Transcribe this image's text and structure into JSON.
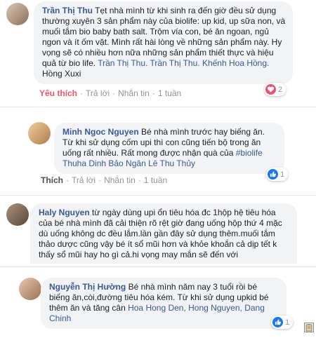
{
  "comments": [
    {
      "author": "Trần Thị Thu",
      "text": "Tẹt nhà mình từ khi sinh ra đến giờ đều sử dụng thường xuyên 3 sản phẩm này của biolife: up kid, up sữa non, và muối tắm bio baby bath salt. Trộm vía con, bé ăn ngoan, ngủ ngon và ít ốm vặt. Mình rất hài lòng về những sản phẩm này. Hy vọng sẽ có nhiều hơn nữa những sản phẩm thiết thực và hiệu quả từ bio life.",
      "tags": "Trần Thị Thu. Trần Thị Thu. Khếnh Hoa Hồng.",
      "tail": " Hồng Xuxi",
      "like_label": "Yêu thích",
      "reply_label": "Trả lời",
      "message_label": "Nhắn tin",
      "time": "1 tuần",
      "reaction_count": "2",
      "reaction_icon": "heart-icon"
    },
    {
      "author": "Minh Ngoc Nguyen",
      "text": "Bé nhà mình trước hay biếng ăn. Từ khi sử dụng cốm upi thì con cũng tiến bộ trong ăn uống rất nhiều. Rất mong được nhận quà của",
      "tags": "#biolife Thuha Dinh Bảo Ngân Lê Thu Thủy",
      "like_label": "Thích",
      "reply_label": "Trả lời",
      "message_label": "Nhắn tin",
      "time": "1 tuần",
      "reaction_count": "1",
      "reaction_icon": "thumb-icon"
    },
    {
      "author": "Haly Nguyen",
      "text": "từ ngày dùng upi ổn tiêu hóa đc 1hộp hệ tiêu hóa của bé nhà mình đã cải thiện rõ rệt giờ đang uống hộp thứ 4 mặc dù uống không dc đều lắm.lần gần đây sử dụng thêm.muối tắm thảo dược cũng vậy bé ít sổ mũi hơn và khỏe khoắn cả dịp tết k thấy sổ mũi hay ho gì cả.hi vọng may mắn sẽ đến với",
      "like_label": "Thích",
      "reply_label": "Trả lời",
      "message_label": "Nhắn tin",
      "time": "1 tuần"
    },
    {
      "author": "Nguyễn Thị Hường",
      "text": "Bé nhà mình năm nay 3 tuổi rồi bé biếng ăn,còi,đường tiêu hóa kém. Từ khi sử dụng upkid bé thêm ăn và tăng cân",
      "tags": "Hoa Hong Den, Hong Nguyen, Dang Chinh",
      "reaction_count": "1",
      "reaction_icon": "thumb-icon"
    }
  ],
  "colors": {
    "link": "#385898",
    "bubble": "#f2f3f5",
    "love": "#f25268",
    "like": "#1877f2"
  }
}
